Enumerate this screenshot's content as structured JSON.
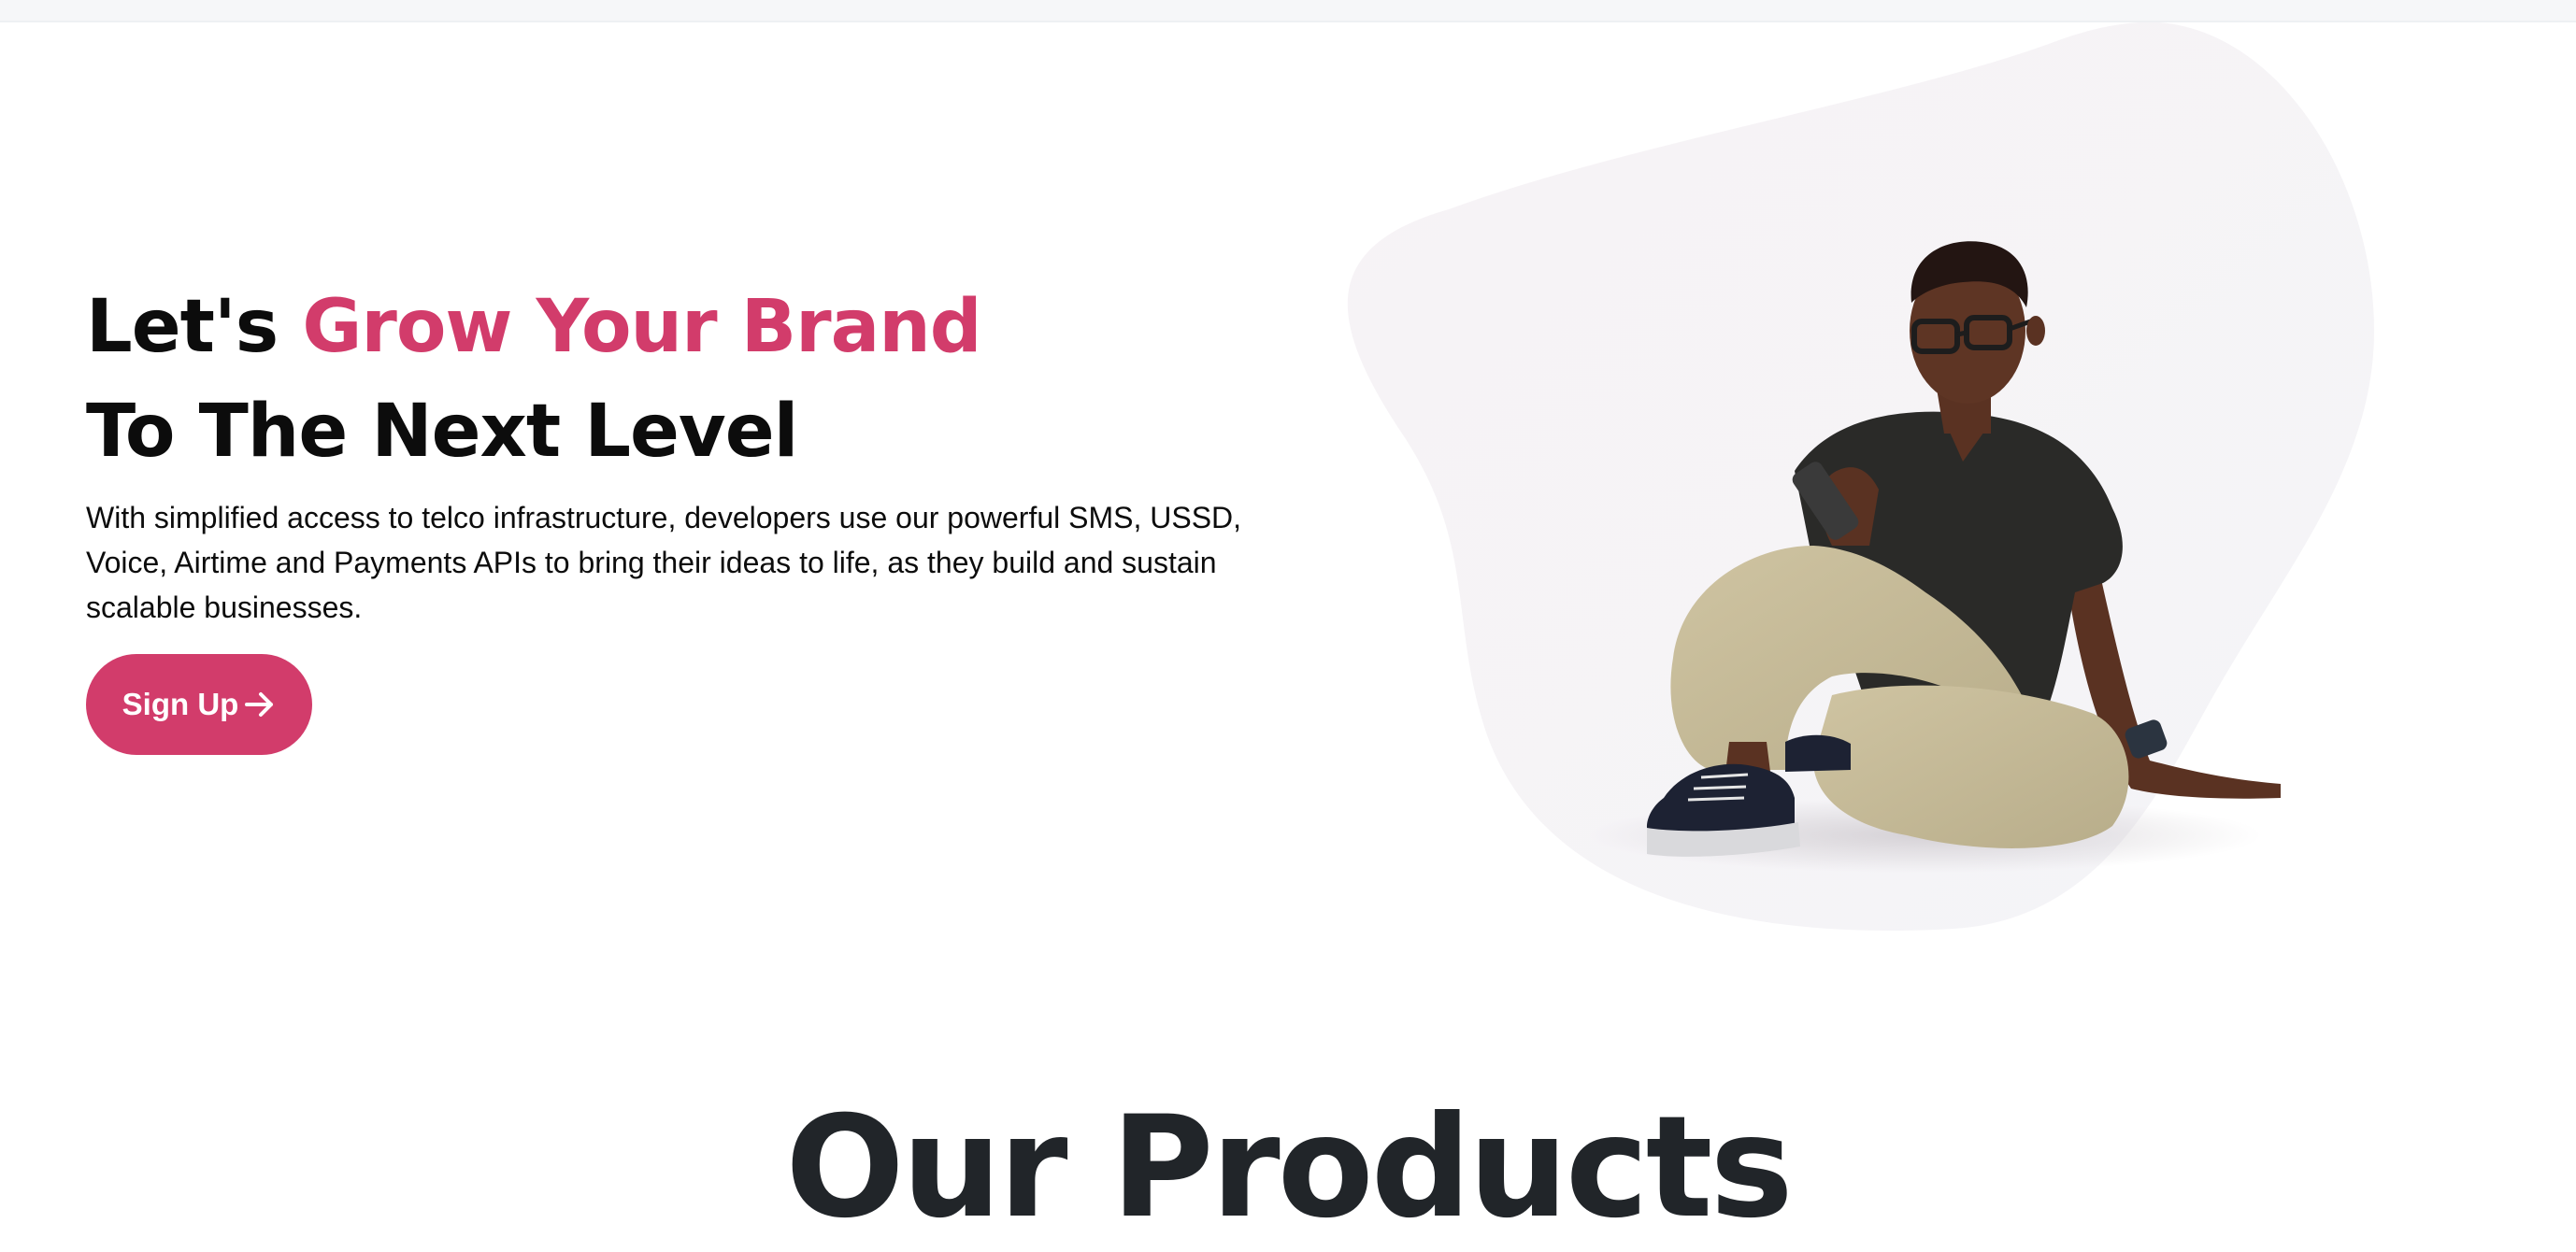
{
  "hero": {
    "headline_prefix": "Let's",
    "headline_accent": "Grow Your Brand",
    "headline_line2": "To The Next Level",
    "description": "With simplified access to telco infrastructure, developers use our powerful SMS, USSD, Voice, Airtime and Payments APIs to bring their ideas to life, as they build and sustain scalable businesses.",
    "cta_label": "Sign Up",
    "cta_icon": "arrow-right-icon"
  },
  "products": {
    "title": "Our Products"
  },
  "colors": {
    "accent": "#d23c6b",
    "text": "#0c0c0c",
    "section_title": "#212529",
    "blob": "#f7f5f7"
  }
}
